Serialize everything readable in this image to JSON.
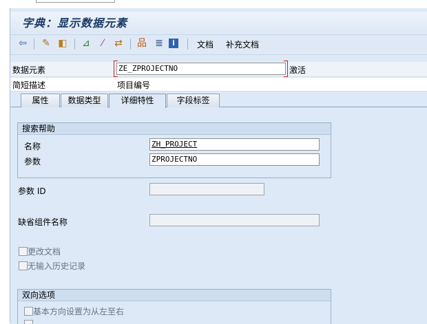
{
  "window": {
    "title": "字典：显示数据元素"
  },
  "toolbar": {
    "icons": [
      "back-icon",
      "display-change-icon",
      "activate-icon",
      "where-used-icon",
      "magic-wand-icon",
      "navigate-icon",
      "hierarchy-icon",
      "list-icon",
      "info-icon"
    ],
    "doc_label": "文档",
    "supp_doc_label": "补充文档"
  },
  "header": {
    "data_element_label": "数据元素",
    "data_element_value": "ZE_ZPROJECTNO",
    "status": "激活",
    "short_desc_label": "简短描述",
    "short_desc_value": "项目编号"
  },
  "tabs": [
    {
      "label": "属性"
    },
    {
      "label": "数据类型"
    },
    {
      "label": "详细特性"
    },
    {
      "label": "字段标签"
    }
  ],
  "active_tab": "详细特性",
  "search_help": {
    "title": "搜索帮助",
    "name_label": "名称",
    "name_value": "ZH_PROJECT",
    "param_label": "参数",
    "param_value": "ZPROJECTNO"
  },
  "parameter_id": {
    "label": "参数 ID",
    "value": ""
  },
  "default_component": {
    "label": "缺省组件名称",
    "value": ""
  },
  "checkboxes": {
    "change_doc": "更改文档",
    "no_history": "无输入历史记录"
  },
  "bidi": {
    "title": "双向选项",
    "ltr": "基本方向设置为从左至右"
  }
}
